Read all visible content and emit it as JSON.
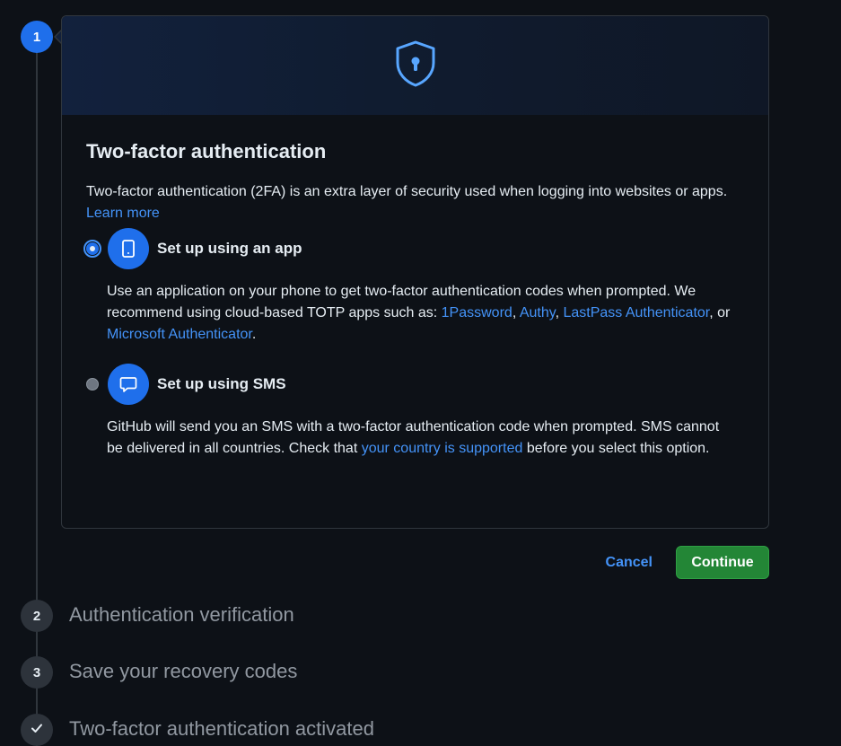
{
  "steps": [
    {
      "number": "1"
    },
    {
      "number": "2",
      "label": "Authentication verification"
    },
    {
      "number": "3",
      "label": "Save your recovery codes"
    },
    {
      "label": "Two-factor authentication activated"
    }
  ],
  "card": {
    "header_icon": "shield-keyhole-icon",
    "title": "Two-factor authentication",
    "description": "Two-factor authentication (2FA) is an extra layer of security used when logging into websites or apps.",
    "learn_more": "Learn more"
  },
  "options": {
    "app": {
      "title": "Set up using an app",
      "icon": "device-mobile-icon",
      "selected": true,
      "desc_1": "Use an application on your phone to get two-factor authentication codes when prompted. We recommend using cloud-based TOTP apps such as: ",
      "link_1password": "1Password",
      "sep_1": ", ",
      "link_authy": "Authy",
      "sep_2": ", ",
      "link_lastpass": "LastPass Authenticator",
      "sep_3": ", or ",
      "link_microsoft": "Microsoft Authenticator",
      "end": "."
    },
    "sms": {
      "title": "Set up using SMS",
      "icon": "comment-icon",
      "selected": false,
      "desc_1": "GitHub will send you an SMS with a two-factor authentication code when prompted. SMS cannot be delivered in all countries. Check that ",
      "link_country": "your country is supported",
      "desc_2": " before you select this option."
    }
  },
  "actions": {
    "cancel": "Cancel",
    "continue": "Continue"
  },
  "colors": {
    "accent": "#1f6feb",
    "link": "#4493f8",
    "primary_button": "#238636",
    "background": "#0d1117"
  }
}
